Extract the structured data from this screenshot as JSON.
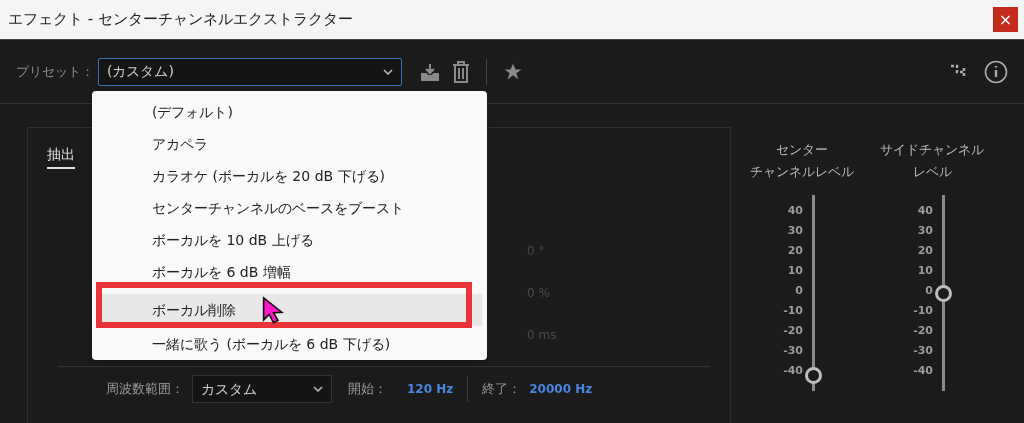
{
  "window": {
    "title": "エフェクト - センターチャンネルエクストラクター",
    "close": "×"
  },
  "preset": {
    "label": "プリセット：",
    "value": "(カスタム)"
  },
  "preset_menu": {
    "items": [
      {
        "label": "(デフォルト)",
        "selected": false
      },
      {
        "label": "アカペラ",
        "selected": false
      },
      {
        "label": "カラオケ (ボーカルを 20 dB 下げる)",
        "selected": false
      },
      {
        "label": "センターチャンネルのベースをブースト",
        "selected": false
      },
      {
        "label": "ボーカルを 10 dB 上げる",
        "selected": false
      },
      {
        "label": "ボーカルを 6 dB 増幅",
        "selected": false
      },
      {
        "label": "ボーカル削除",
        "selected": true
      },
      {
        "label": "一緒に歌う (ボーカルを 6 dB 下げる)",
        "selected": false
      }
    ]
  },
  "tabs": [
    {
      "label": "抽出",
      "selected": true
    }
  ],
  "readings": [
    "0 °",
    "0 %",
    "0 ms"
  ],
  "frequency": {
    "label": "周波数範囲：",
    "value": "カスタム",
    "start_label": "開始：",
    "start": "120 Hz",
    "end_label": "終了：",
    "end": "20000 Hz"
  },
  "sliders": [
    {
      "label_lines": [
        "センター",
        "チャンネルレベル"
      ],
      "level": 0.08,
      "scale": [
        "40",
        "30",
        "20",
        "10",
        "0",
        "-10",
        "-20",
        "-30",
        "-40"
      ]
    },
    {
      "label_lines": [
        "サイドチャンネル",
        "レベル"
      ],
      "level": 0.5,
      "scale": [
        "40",
        "30",
        "20",
        "10",
        "0",
        "-10",
        "-20",
        "-30",
        "-40"
      ]
    }
  ]
}
